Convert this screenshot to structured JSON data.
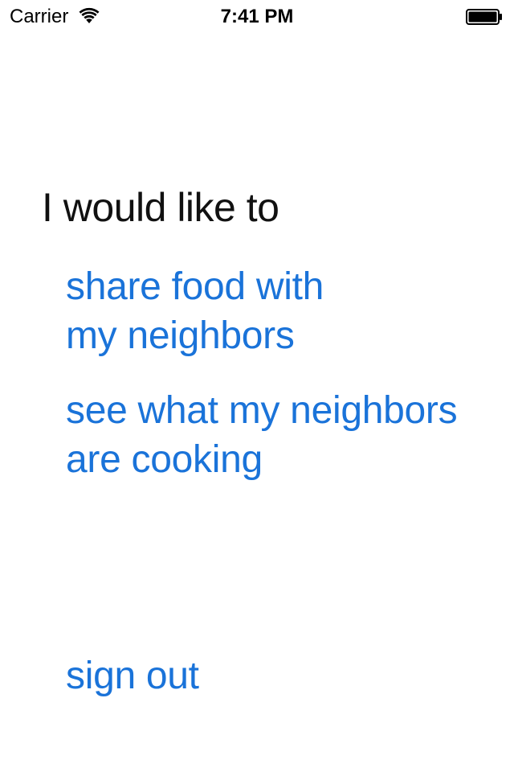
{
  "status_bar": {
    "carrier": "Carrier",
    "time": "7:41 PM",
    "wifi_icon": "wifi-icon",
    "battery_icon": "battery-icon"
  },
  "main": {
    "heading": "I would like to",
    "options": [
      {
        "line1": "share food with",
        "line2": "my neighbors"
      },
      {
        "line1": "see what my neighbors",
        "line2": "are cooking"
      }
    ],
    "sign_out": "sign out"
  },
  "colors": {
    "link": "#1a73d9",
    "text": "#111111",
    "background": "#ffffff"
  }
}
